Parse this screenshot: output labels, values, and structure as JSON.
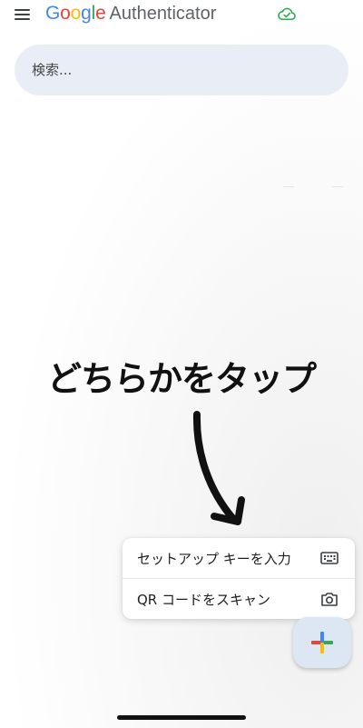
{
  "app": {
    "brand_letters": [
      "G",
      "o",
      "o",
      "g",
      "l",
      "e"
    ],
    "product": "Authenticator",
    "brand_colors": [
      "#4285F4",
      "#EA4335",
      "#FBBC05",
      "#4285F4",
      "#34A853",
      "#EA4335"
    ],
    "sync_status_icon": "cloud-check-icon",
    "sync_color": "#34A853"
  },
  "search": {
    "placeholder": "検索..."
  },
  "annotation": {
    "text": "どちらかをタップ",
    "arrow_icon": "curved-arrow-down-icon"
  },
  "add_menu": {
    "items": [
      {
        "label": "セットアップ キーを入力",
        "icon": "keyboard-icon"
      },
      {
        "label": "QR コードをスキャン",
        "icon": "camera-icon"
      }
    ]
  },
  "fab": {
    "icon": "plus-icon",
    "colors": [
      "#EA4335",
      "#4285F4",
      "#FBBC05",
      "#34A853"
    ]
  }
}
